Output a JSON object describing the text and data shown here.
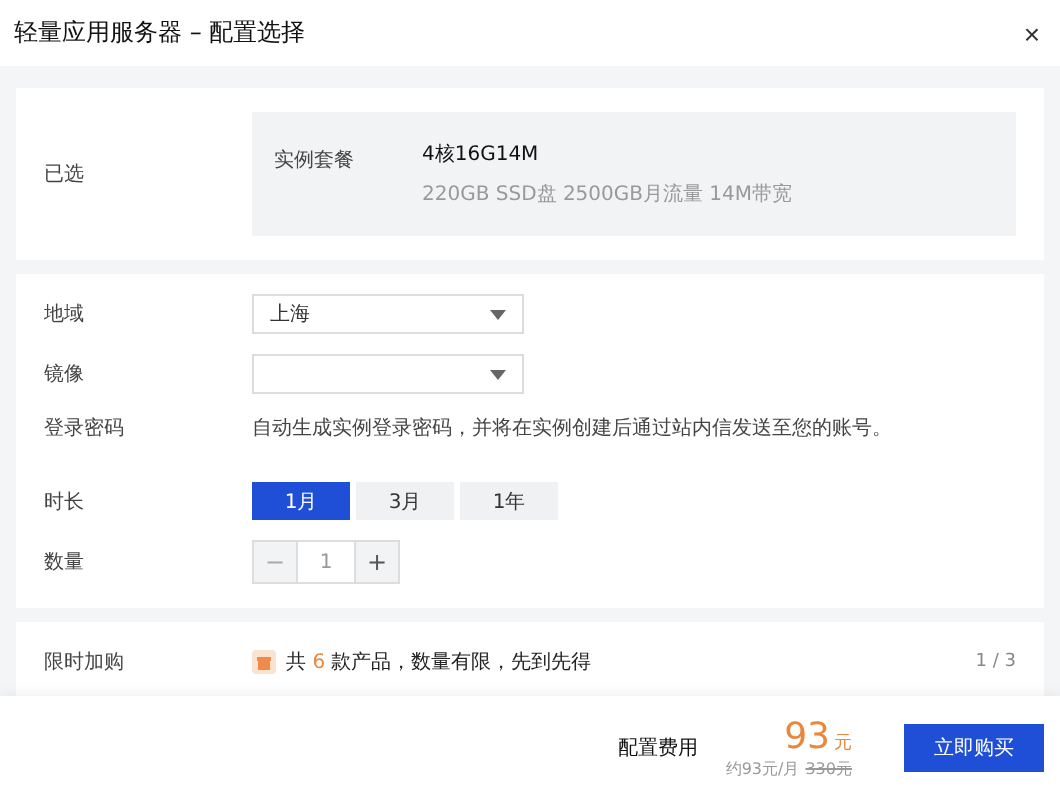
{
  "window": {
    "title": "轻量应用服务器 – 配置选择",
    "close": "×"
  },
  "selected": {
    "label": "已选",
    "package_label": "实例套餐",
    "package": "4核16G14M",
    "package_detail": "220GB SSD盘 2500GB月流量 14M带宽"
  },
  "region": {
    "label": "地域",
    "value": "上海"
  },
  "image": {
    "label": "镜像"
  },
  "password": {
    "label": "登录密码",
    "note": "自动生成实例登录密码，并将在实例创建后通过站内信发送至您的账号。"
  },
  "duration": {
    "label": "时长",
    "options": [
      {
        "label": "1月",
        "selected": true
      },
      {
        "label": "3月",
        "selected": false
      },
      {
        "label": "1年",
        "selected": false
      }
    ]
  },
  "quantity": {
    "label": "数量",
    "minus": "−",
    "value": "1",
    "plus": "+"
  },
  "addon": {
    "label": "限时加购",
    "text": "共 **6** 款产品，数量有限，先到先得",
    "pager": "1 / 3"
  },
  "footer": {
    "fee_label": "配置费用",
    "price": "93",
    "unit": "元",
    "monthly": "约93元/月",
    "original": "330元",
    "buy": "立即购买"
  }
}
